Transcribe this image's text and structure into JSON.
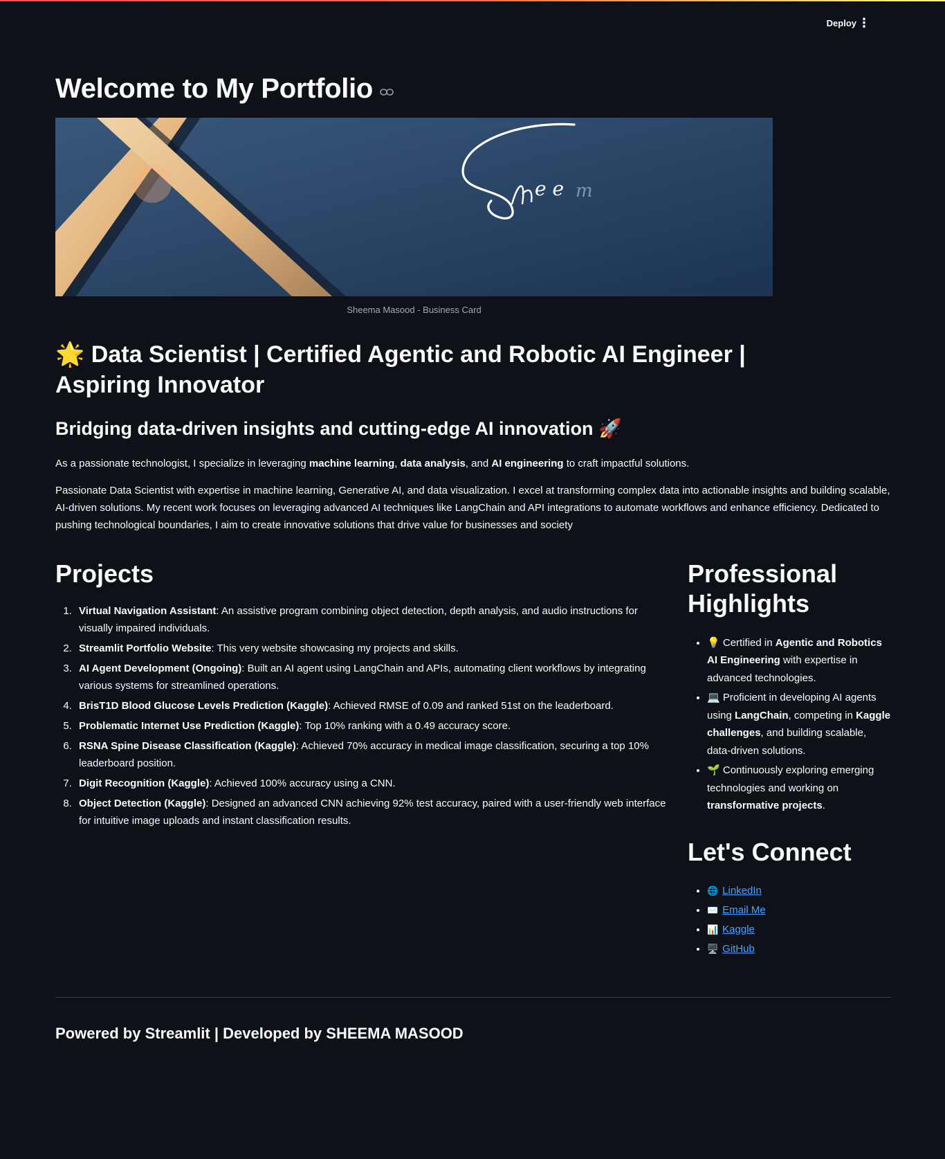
{
  "header": {
    "deploy_label": "Deploy",
    "menu_icon": "kebab-menu-icon"
  },
  "page": {
    "title": "Welcome to My Portfolio",
    "anchor_icon": "link-icon"
  },
  "banner": {
    "signature": "Sheem",
    "caption": "Sheema Masood - Business Card"
  },
  "role": {
    "star": "🌟",
    "text": "Data Scientist | Certified Agentic and Robotic AI Engineer | Aspiring Innovator"
  },
  "tagline": {
    "text": "Bridging data-driven insights and cutting-edge AI innovation",
    "emoji": "🚀"
  },
  "intro": {
    "p1_a": "As a passionate technologist, I specialize in leveraging ",
    "p1_b": "machine learning",
    "p1_c": ", ",
    "p1_d": "data analysis",
    "p1_e": ", and ",
    "p1_f": "AI engineering",
    "p1_g": " to craft impactful solutions.",
    "p2": "Passionate Data Scientist with expertise in machine learning, Generative AI, and data visualization. I excel at transforming complex data into actionable insights and building scalable, AI-driven solutions. My recent work focuses on leveraging advanced AI techniques like LangChain and API integrations to automate workflows and enhance efficiency. Dedicated to pushing technological boundaries, I aim to create innovative solutions that drive value for businesses and society"
  },
  "projects": {
    "title": "Projects",
    "items": [
      {
        "name": "Virtual Navigation Assistant",
        "desc": ": An assistive program combining object detection, depth analysis, and audio instructions for visually impaired individuals."
      },
      {
        "name": "Streamlit Portfolio Website",
        "desc": ": This very website showcasing my projects and skills."
      },
      {
        "name": "AI Agent Development (Ongoing)",
        "desc": ": Built an AI agent using LangChain and APIs, automating client workflows by integrating various systems for streamlined operations."
      },
      {
        "name": "BrisT1D Blood Glucose Levels Prediction (Kaggle)",
        "desc": ": Achieved RMSE of 0.09 and ranked 51st on the leaderboard."
      },
      {
        "name": "Problematic Internet Use Prediction (Kaggle)",
        "desc": ": Top 10% ranking with a 0.49 accuracy score."
      },
      {
        "name": "RSNA Spine Disease Classification (Kaggle)",
        "desc": ": Achieved 70% accuracy in medical image classification, securing a top 10% leaderboard position."
      },
      {
        "name": "Digit Recognition (Kaggle)",
        "desc": ": Achieved 100% accuracy using a CNN."
      },
      {
        "name": "Object Detection (Kaggle)",
        "desc": ": Designed an advanced CNN achieving 92% test accuracy, paired with a user-friendly web interface for intuitive image uploads and instant classification results."
      }
    ]
  },
  "highlights": {
    "title": "Professional Highlights",
    "h1_emoji": "💡",
    "h1_a": " Certified in ",
    "h1_b": "Agentic and Robotics AI Engineering",
    "h1_c": " with expertise in advanced technologies.",
    "h2_emoji": "💻",
    "h2_a": " Proficient in developing AI agents using ",
    "h2_b": "LangChain",
    "h2_c": ", competing in ",
    "h2_d": "Kaggle challenges",
    "h2_e": ", and building scalable, data-driven solutions.",
    "h3_emoji": "🌱",
    "h3_a": " Continuously exploring emerging technologies and working on ",
    "h3_b": "transformative projects",
    "h3_c": "."
  },
  "connect": {
    "title": "Let's Connect",
    "links": [
      {
        "emoji": "🌐",
        "label": "LinkedIn"
      },
      {
        "emoji": "✉️",
        "label": "Email Me"
      },
      {
        "emoji": "📊",
        "label": "Kaggle"
      },
      {
        "emoji": "🖥️",
        "label": "GitHub"
      }
    ]
  },
  "footer": {
    "text": "Powered by Streamlit | Developed by SHEEMA MASOOD"
  },
  "colors": {
    "background": "#0e1117",
    "text": "#fafafa",
    "link": "#4aa3ff",
    "caption": "#a3a8b8"
  }
}
